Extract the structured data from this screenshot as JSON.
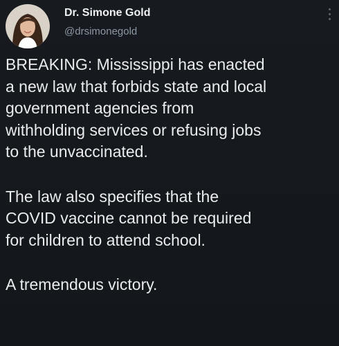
{
  "tweet": {
    "author": {
      "display_name": "Dr. Simone Gold",
      "handle": "@drsimonegold",
      "avatar_icon": "profile-photo"
    },
    "menu_icon": "more-vertical-icon",
    "paragraphs": [
      {
        "lines": [
          "BREAKING: Mississippi has enacted",
          "a new law that forbids state and local",
          "government agencies from",
          "withholding services or refusing jobs",
          "to the unvaccinated."
        ]
      },
      {
        "lines": [
          "The law also specifies that the",
          "COVID vaccine cannot be required",
          "for children to attend school."
        ]
      },
      {
        "lines": [
          "A tremendous victory."
        ]
      }
    ]
  },
  "colors": {
    "background": "#15191e",
    "text": "#e9ebed",
    "handle": "#8b97a2",
    "muted_icon": "#5b6670"
  }
}
